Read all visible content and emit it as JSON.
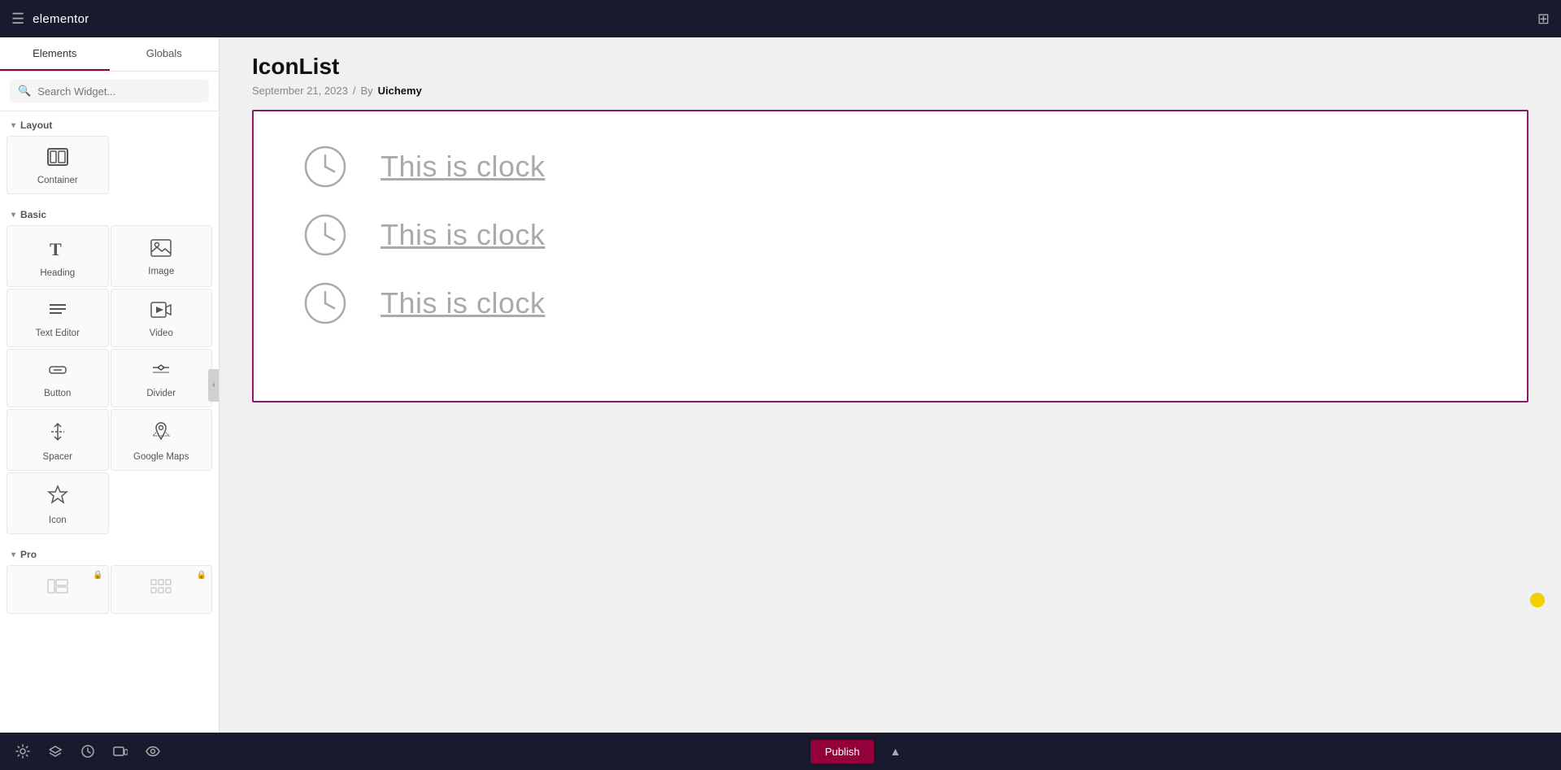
{
  "topbar": {
    "title": "elementor",
    "hamburger_label": "☰",
    "grid_label": "⊞"
  },
  "sidebar": {
    "tabs": [
      {
        "id": "elements",
        "label": "Elements",
        "active": true
      },
      {
        "id": "globals",
        "label": "Globals",
        "active": false
      }
    ],
    "search": {
      "placeholder": "Search Widget..."
    },
    "sections": [
      {
        "id": "layout",
        "label": "Layout",
        "widgets": [
          {
            "id": "container",
            "label": "Container",
            "icon": "container"
          }
        ]
      },
      {
        "id": "basic",
        "label": "Basic",
        "widgets": [
          {
            "id": "heading",
            "label": "Heading",
            "icon": "heading"
          },
          {
            "id": "image",
            "label": "Image",
            "icon": "image"
          },
          {
            "id": "text-editor",
            "label": "Text Editor",
            "icon": "text-editor"
          },
          {
            "id": "video",
            "label": "Video",
            "icon": "video"
          },
          {
            "id": "button",
            "label": "Button",
            "icon": "button"
          },
          {
            "id": "divider",
            "label": "Divider",
            "icon": "divider"
          },
          {
            "id": "spacer",
            "label": "Spacer",
            "icon": "spacer"
          },
          {
            "id": "google-maps",
            "label": "Google Maps",
            "icon": "google-maps"
          },
          {
            "id": "icon",
            "label": "Icon",
            "icon": "icon"
          }
        ]
      },
      {
        "id": "pro",
        "label": "Pro",
        "widgets": [
          {
            "id": "pro-widget-1",
            "label": "",
            "icon": "pro1",
            "locked": true
          },
          {
            "id": "pro-widget-2",
            "label": "",
            "icon": "pro2",
            "locked": true
          }
        ]
      }
    ]
  },
  "page": {
    "title": "IconList",
    "meta_date": "September 21, 2023",
    "meta_separator": "/",
    "meta_by": "By",
    "meta_author": "Uichemy"
  },
  "icon_list": {
    "items": [
      {
        "id": 1,
        "text": "This is clock"
      },
      {
        "id": 2,
        "text": "This is clock"
      },
      {
        "id": 3,
        "text": "This is clock"
      }
    ]
  },
  "bottom_toolbar": {
    "publish_label": "Publish",
    "icons": [
      "settings",
      "layers",
      "history",
      "responsive",
      "eye",
      "scroll-up"
    ]
  }
}
